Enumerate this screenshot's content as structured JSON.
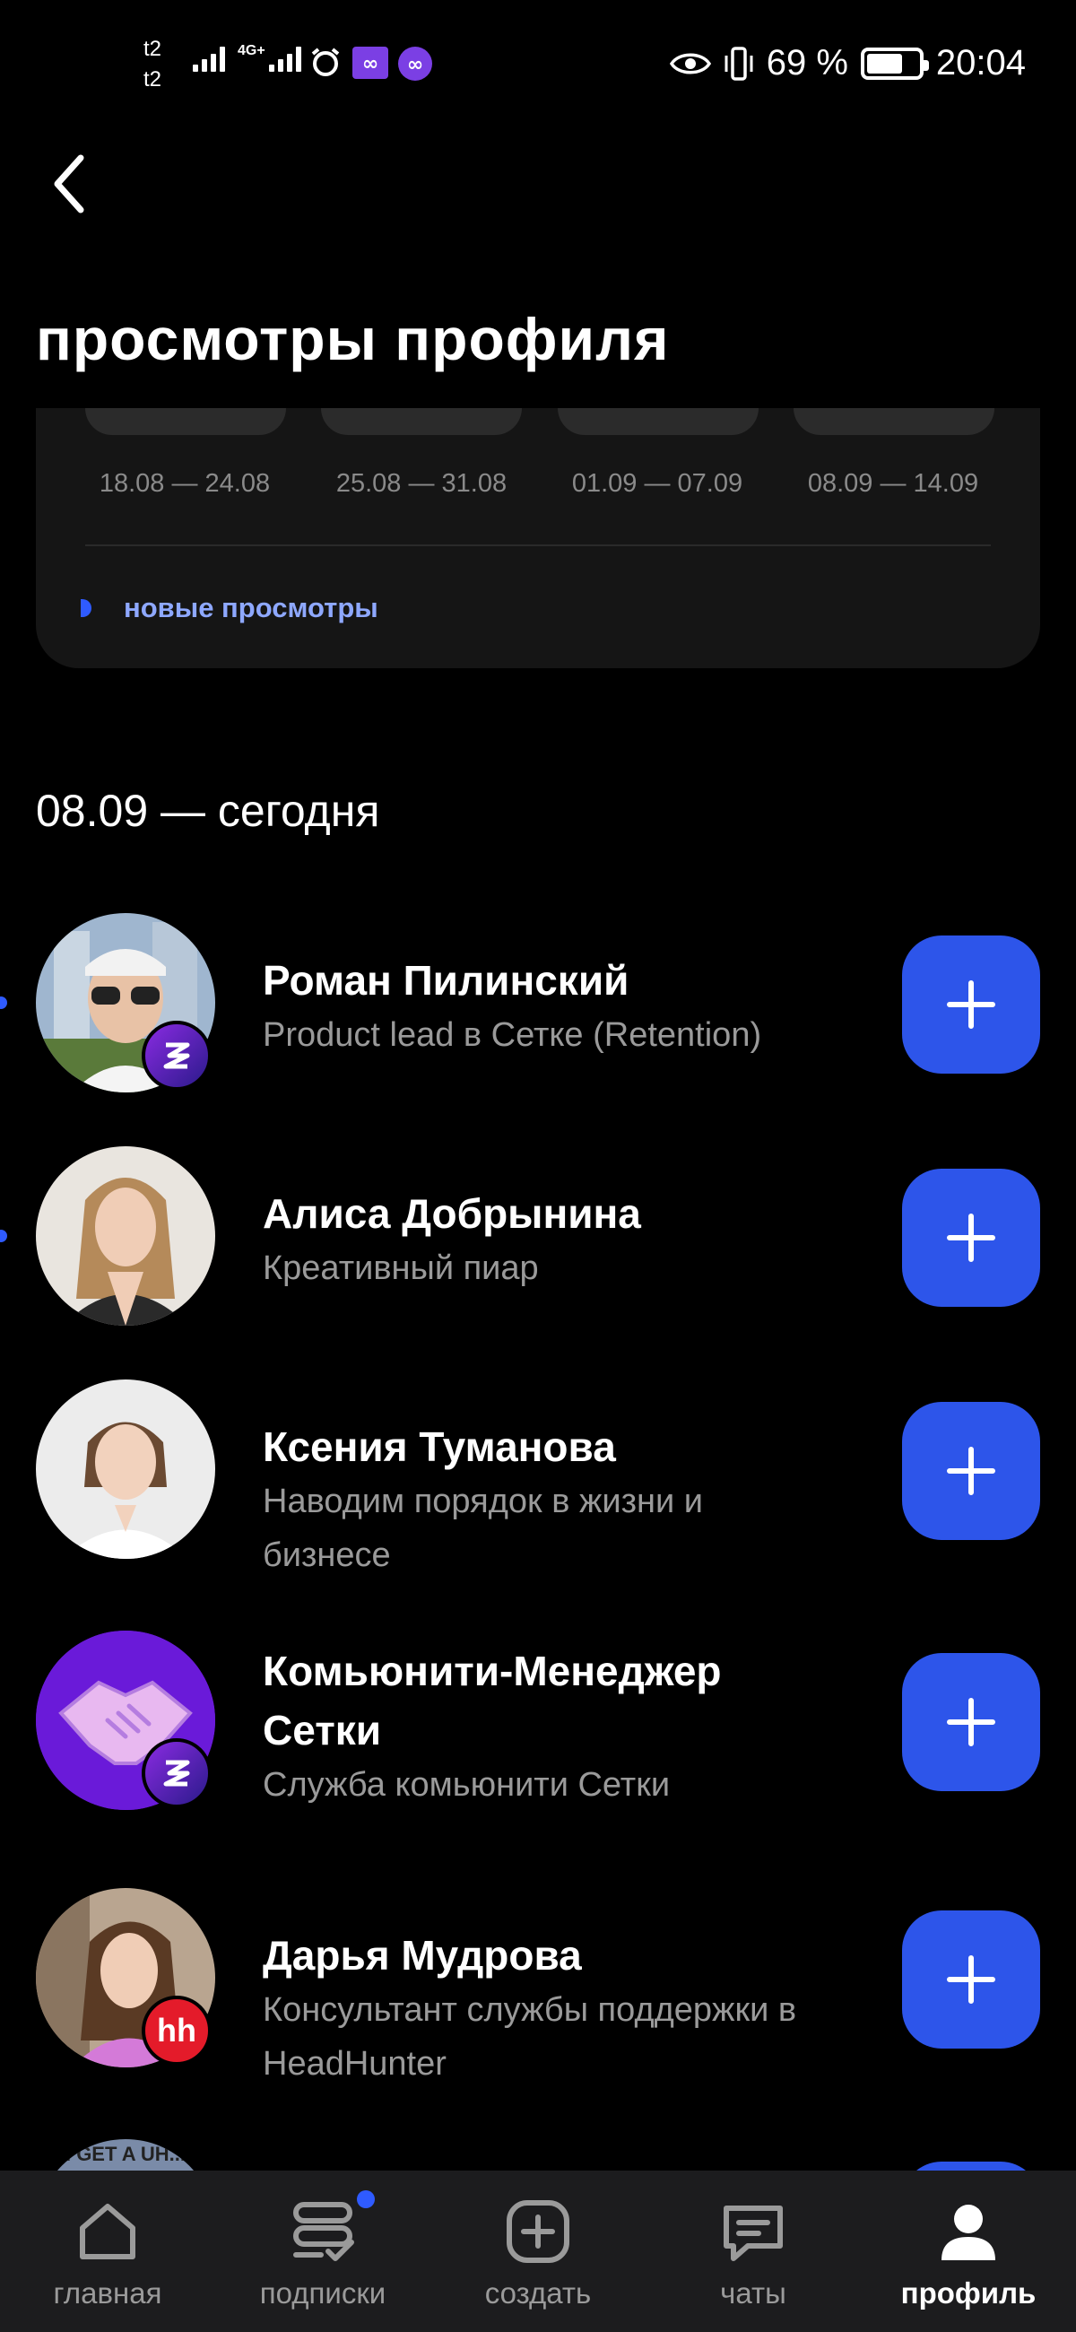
{
  "status_bar": {
    "carrier_1": "t2",
    "carrier_2": "t2",
    "network": "4G+",
    "battery_percent": "69 %",
    "battery_level": 0.69,
    "time": "20:04"
  },
  "header": {
    "back_icon": "chevron-left-icon",
    "title": "просмотры профиля"
  },
  "chart_card": {
    "weeks": [
      "18.08 — 24.08",
      "25.08 — 31.08",
      "01.09 — 07.09",
      "08.09 — 14.09"
    ],
    "legend": "новые просмотры",
    "legend_color": "#2f5bff"
  },
  "section": {
    "title": "08.09 — сегодня"
  },
  "visitors": [
    {
      "name": "Роман Пилинский",
      "description": "Product lead в Сетке (Retention)",
      "badge": "setka",
      "unread": true
    },
    {
      "name": "Алиса Добрынина",
      "description": "Креативный пиар",
      "badge": "",
      "unread": true
    },
    {
      "name": "Ксения Туманова",
      "description": "Наводим порядок в жизни и бизнесе",
      "badge": "",
      "unread": false
    },
    {
      "name": "Комьюнити-Менеджер Сетки",
      "description": "Служба комьюнити Сетки",
      "badge": "setka",
      "unread": false
    },
    {
      "name": "Дарья Мудрова",
      "description": "Консультант службы поддержки в HeadHunter",
      "badge": "hh",
      "badge_text": "hh",
      "unread": false
    }
  ],
  "partial_visitor": {
    "avatar_text": "I GET A UH..."
  },
  "colors": {
    "accent": "#2d55ea",
    "background": "#000000",
    "card": "#151515",
    "nav": "#1c1c1e"
  },
  "bottom_nav": [
    {
      "label": "главная",
      "icon": "home-icon"
    },
    {
      "label": "подписки",
      "icon": "subscriptions-icon",
      "badge": true
    },
    {
      "label": "создать",
      "icon": "create-icon"
    },
    {
      "label": "чаты",
      "icon": "chat-icon"
    },
    {
      "label": "профиль",
      "icon": "profile-icon",
      "active": true
    }
  ]
}
